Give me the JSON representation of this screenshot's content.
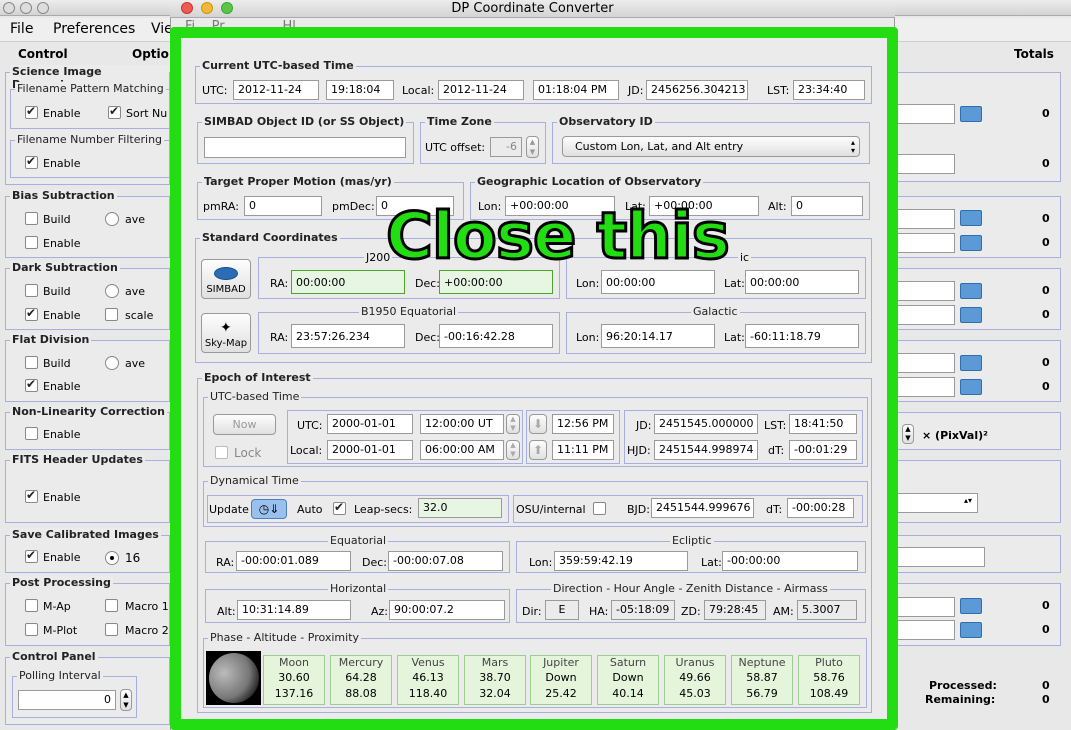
{
  "window": {
    "title": "DP Coordinate Converter"
  },
  "menu": [
    "File",
    "Preferences",
    "Vie"
  ],
  "behind_menu_partial": "Fi    Pr              Hl",
  "left_panel": {
    "col_control": "Control",
    "col_options": "Optio",
    "sections": {
      "science": "Science Image Processing",
      "filename_pattern": "Filename Pattern Matching",
      "enable": "Enable",
      "sort_num": "Sort Nu",
      "filename_number": "Filename Number Filtering",
      "bias": "Bias Subtraction",
      "build": "Build",
      "ave": "ave",
      "dark": "Dark Subtraction",
      "scale": "scale",
      "flat": "Flat Division",
      "nonlin": "Non-Linearity Correction",
      "fits": "FITS Header Updates",
      "save": "Save Calibrated Images",
      "sixteen": "16",
      "post": "Post Processing",
      "map": "M-Ap",
      "mplot": "M-Plot",
      "macro1": "Macro 1",
      "macro2": "Macro 2",
      "control_panel": "Control Panel",
      "polling": "Polling Interval",
      "polling_val": "0"
    }
  },
  "right_panel": {
    "totals": "Totals",
    "zero": "0",
    "pix_label": "× (PixVal)²",
    "processed": "Processed:",
    "remaining": "Remaining:",
    "processed_val": "0",
    "remaining_val": "0"
  },
  "overlay": {
    "text": "Close this",
    "color": "#22dd11"
  },
  "current_time": {
    "title": "Current UTC-based Time",
    "utc_label": "UTC:",
    "utc_date": "2012-11-24",
    "utc_time": "19:18:04",
    "local_label": "Local:",
    "local_date": "2012-11-24",
    "local_time": "01:18:04 PM",
    "jd_label": "JD:",
    "jd": "2456256.304213",
    "lst_label": "LST:",
    "lst": "23:34:40"
  },
  "simbad": {
    "title": "SIMBAD Object ID (or SS Object)",
    "value": ""
  },
  "timezone": {
    "title": "Time Zone",
    "label": "UTC offset:",
    "value": "-6"
  },
  "observatory": {
    "title": "Observatory ID",
    "selected": "Custom Lon, Lat, and Alt entry"
  },
  "proper_motion": {
    "title": "Target Proper Motion (mas/yr)",
    "pmra_label": "pmRA:",
    "pmra": "0",
    "pmdec_label": "pmDec:",
    "pmdec": "0"
  },
  "geo": {
    "title": "Geographic Location of Observatory",
    "lon_label": "Lon:",
    "lon": "+00:00:00",
    "lat_label": "Lat:",
    "lat": "+00:00:00",
    "alt_label": "Alt:",
    "alt": "0"
  },
  "std": {
    "title": "Standard Coordinates",
    "simbad_btn": "SIMBAD",
    "skymap_btn": "Sky-Map",
    "j2000": "J200",
    "ecliptic_partial": "ic",
    "ra_label": "RA:",
    "ra": "00:00:00",
    "dec_label": "Dec:",
    "dec": "+00:00:00",
    "elon_label": "Lon:",
    "elon": "00:00:00",
    "elat_label": "Lat:",
    "elat": "00:00:00",
    "b1950": "B1950 Equatorial",
    "bra": "23:57:26.234",
    "bdec": "-00:16:42.28",
    "galactic": "Galactic",
    "glon": "96:20:14.17",
    "glat": "-60:11:18.79"
  },
  "epoch": {
    "title": "Epoch of Interest",
    "utc_title": "UTC-based Time",
    "now": "Now",
    "lock": "Lock",
    "utc_label": "UTC:",
    "utc_date": "2000-01-01",
    "utc_time": "12:00:00 UT",
    "local_label": "Local:",
    "local_date": "2000-01-01",
    "local_time": "06:00:00 AM",
    "t1": "12:56 PM",
    "t2": "11:11 PM",
    "jd_label": "JD:",
    "jd": "2451545.000000",
    "lst_label": "LST:",
    "lst": "18:41:50",
    "hjd_label": "HJD:",
    "hjd": "2451544.998974",
    "dt_label": "dT:",
    "dt": "-00:01:29",
    "dyn_title": "Dynamical Time",
    "update": "Update",
    "auto": "Auto",
    "leap_label": "Leap-secs:",
    "leap": "32.0",
    "osu": "OSU/internal",
    "bjd_label": "BJD:",
    "bjd": "2451544.999676",
    "dt2": "-00:00:28",
    "eq_title": "Equatorial",
    "ra": "-00:00:01.089",
    "dec": "-00:00:07.08",
    "ecl_title": "Ecliptic",
    "lon": "359:59:42.19",
    "lat": "-00:00:00",
    "hor_title": "Horizontal",
    "alt_label": "Alt:",
    "alt": "10:31:14.89",
    "az_label": "Az:",
    "az": "90:00:07.2",
    "dir_title": "Direction - Hour Angle - Zenith Distance - Airmass",
    "dir_label": "Dir:",
    "dir": "E",
    "ha_label": "HA:",
    "ha": "-05:18:09",
    "zd_label": "ZD:",
    "zd": "79:28:45",
    "am_label": "AM:",
    "am": "5.3007",
    "phase_title": "Phase - Altitude - Proximity"
  },
  "planets": [
    {
      "name": "Moon",
      "a": "30.60",
      "b": "137.16"
    },
    {
      "name": "Mercury",
      "a": "64.28",
      "b": "88.08"
    },
    {
      "name": "Venus",
      "a": "46.13",
      "b": "118.40"
    },
    {
      "name": "Mars",
      "a": "38.70",
      "b": "32.04"
    },
    {
      "name": "Jupiter",
      "a": "Down",
      "b": "25.42"
    },
    {
      "name": "Saturn",
      "a": "Down",
      "b": "40.14"
    },
    {
      "name": "Uranus",
      "a": "49.66",
      "b": "45.03"
    },
    {
      "name": "Neptune",
      "a": "58.87",
      "b": "56.79"
    },
    {
      "name": "Pluto",
      "a": "58.76",
      "b": "108.49"
    }
  ]
}
